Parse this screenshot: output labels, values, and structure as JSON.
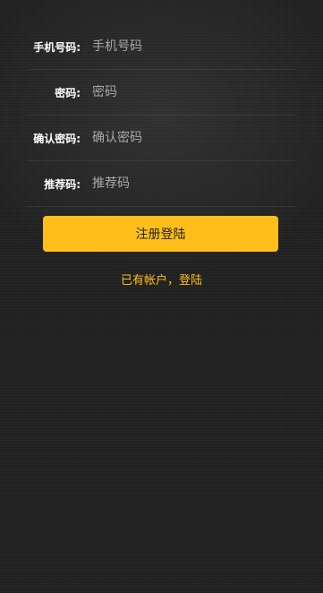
{
  "form": {
    "fields": [
      {
        "label": "手机号码:",
        "placeholder": "手机号码",
        "value": ""
      },
      {
        "label": "密码:",
        "placeholder": "密码",
        "value": ""
      },
      {
        "label": "确认密码:",
        "placeholder": "确认密码",
        "value": ""
      },
      {
        "label": "推荐码:",
        "placeholder": "推荐码",
        "value": ""
      }
    ],
    "submit_label": "注册登陆",
    "login_link": "已有帐户，登陆"
  },
  "colors": {
    "accent": "#ffbf1a",
    "background": "#262626",
    "label": "#ffffff",
    "placeholder": "#a8a8a8"
  }
}
